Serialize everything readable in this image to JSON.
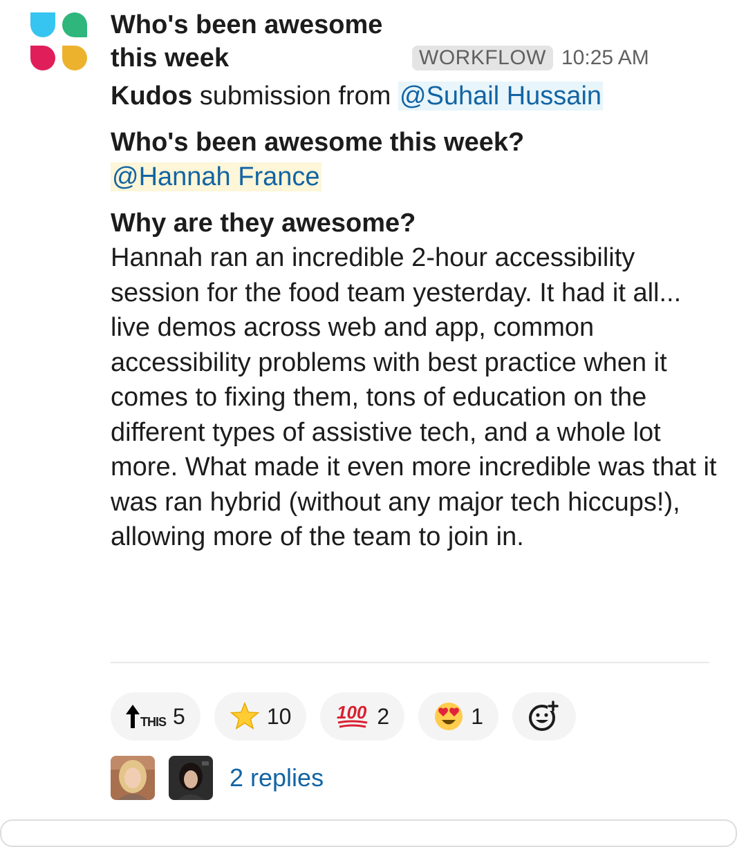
{
  "message": {
    "sender": "Who's been awesome this week",
    "badge": "WORKFLOW",
    "time": "10:25 AM",
    "intro": {
      "bold": "Kudos",
      "text": " submission from ",
      "mention": "@Suhail Hussain"
    },
    "q1": "Who's been awesome this week?",
    "a1_mention": "@Hannah France",
    "q2": "Why are they awesome?",
    "a2": "Hannah ran an incredible 2-hour accessibility session for the food team yesterday. It had it all... live demos across web and app, common accessibility problems with best practice when it comes to fixing them, tons of education on the different types of assistive tech, and a whole lot more. What made it even more incredible was that it was ran hybrid (without any major tech hiccups!), allowing more of the team to join in."
  },
  "reactions": [
    {
      "emoji": "this-arrow",
      "label": "THIS",
      "count": "5"
    },
    {
      "emoji": "star",
      "count": "10"
    },
    {
      "emoji": "hundred-points",
      "count": "2"
    },
    {
      "emoji": "heart-eyes",
      "count": "1"
    }
  ],
  "thread": {
    "replies_label": "2 replies"
  },
  "colors": {
    "link": "#1264a3",
    "mention_bg_blue": "#e8f5fa",
    "mention_bg_yellow": "#fdf6d8",
    "icon_blue": "#36c5f0",
    "icon_green": "#2eb67d",
    "icon_red": "#e01e5a",
    "icon_yellow": "#ecb22e"
  }
}
